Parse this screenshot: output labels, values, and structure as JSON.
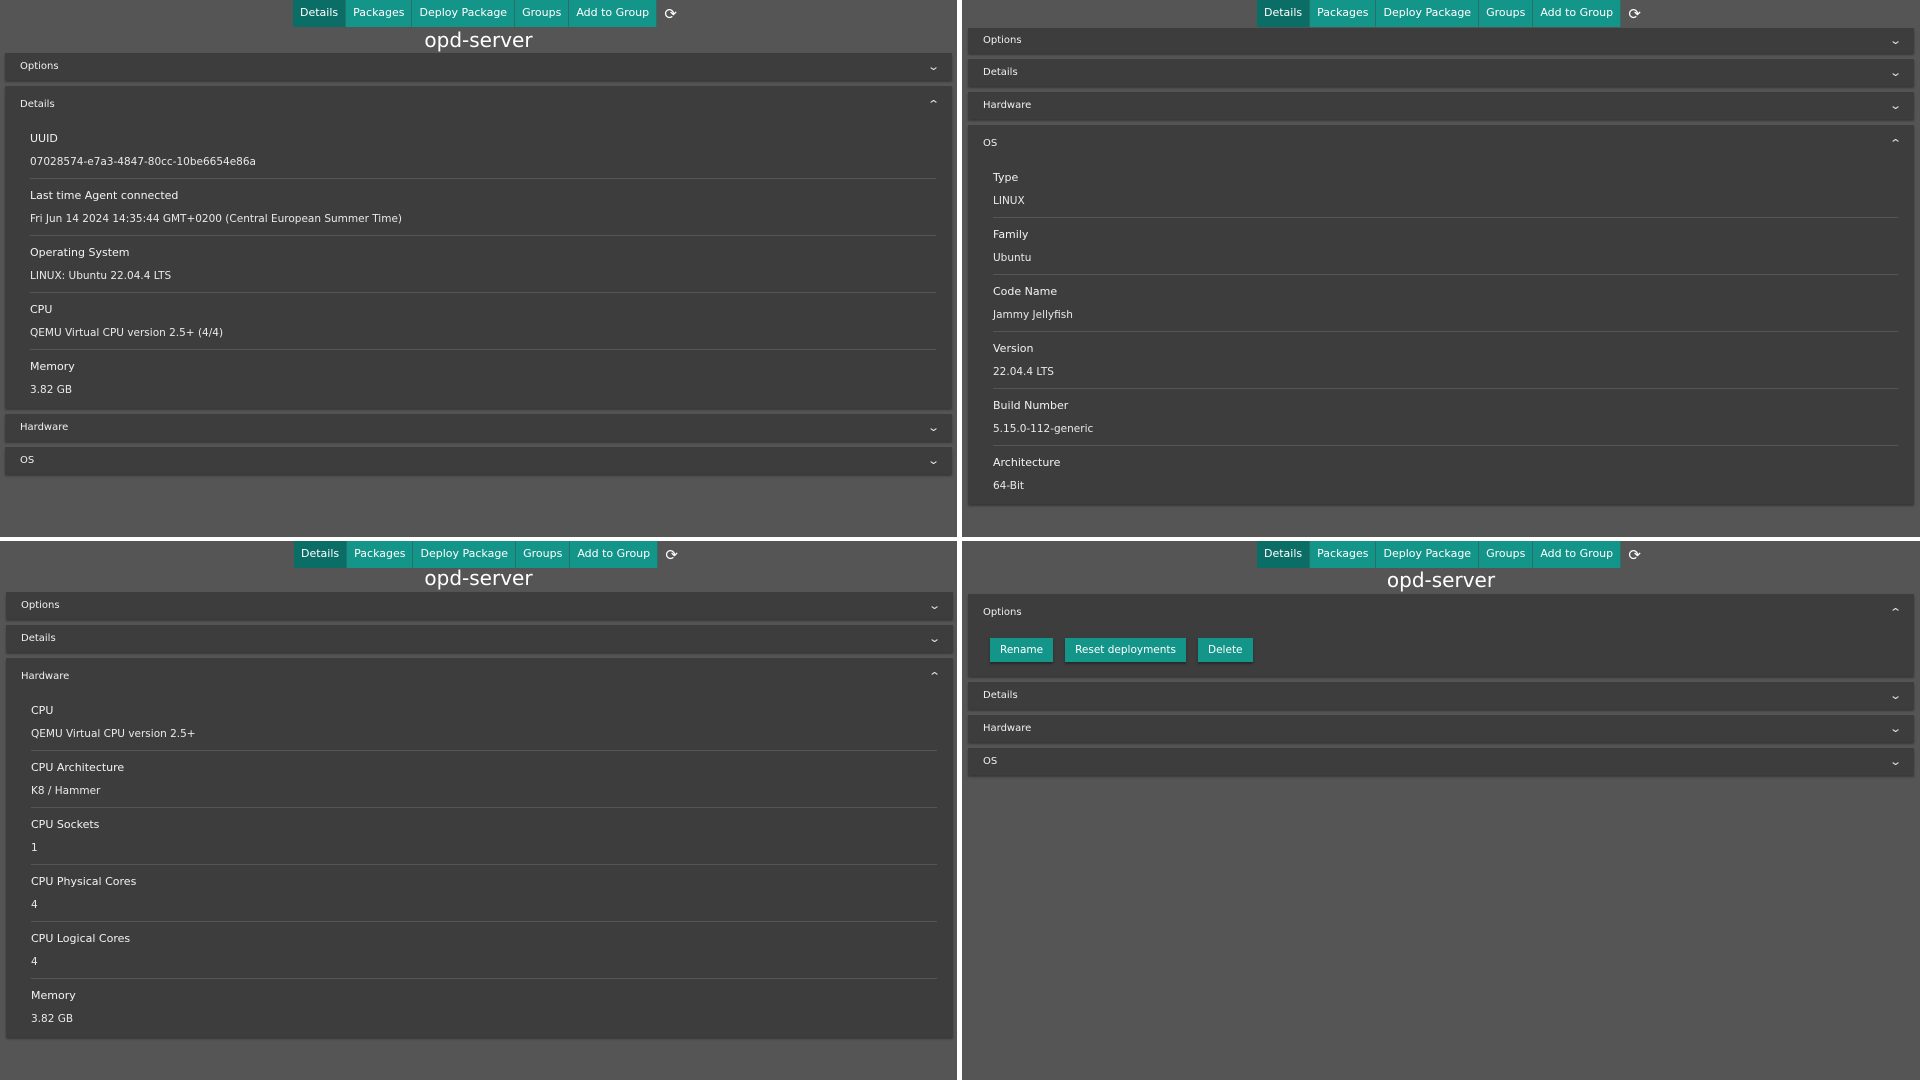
{
  "tabs": [
    "Details",
    "Packages",
    "Deploy Package",
    "Groups",
    "Add to Group"
  ],
  "refresh_icon": "refresh-icon",
  "server_name": "opd-server",
  "panels": {
    "options": "Options",
    "details": "Details",
    "hardware": "Hardware",
    "os": "OS"
  },
  "details_fields": [
    {
      "label": "UUID",
      "value": "07028574-e7a3-4847-80cc-10be6654e86a"
    },
    {
      "label": "Last time Agent connected",
      "value": "Fri Jun 14 2024 14:35:44 GMT+0200 (Central European Summer Time)"
    },
    {
      "label": "Operating System",
      "value": "LINUX: Ubuntu 22.04.4 LTS"
    },
    {
      "label": "CPU",
      "value": "QEMU Virtual CPU version 2.5+ (4/4)"
    },
    {
      "label": "Memory",
      "value": "3.82 GB"
    }
  ],
  "os_fields": [
    {
      "label": "Type",
      "value": "LINUX"
    },
    {
      "label": "Family",
      "value": "Ubuntu"
    },
    {
      "label": "Code Name",
      "value": "Jammy Jellyfish"
    },
    {
      "label": "Version",
      "value": "22.04.4 LTS"
    },
    {
      "label": "Build Number",
      "value": "5.15.0-112-generic"
    },
    {
      "label": "Architecture",
      "value": "64-Bit"
    }
  ],
  "hardware_fields": [
    {
      "label": "CPU",
      "value": "QEMU Virtual CPU version 2.5+"
    },
    {
      "label": "CPU Architecture",
      "value": "K8 / Hammer"
    },
    {
      "label": "CPU Sockets",
      "value": "1"
    },
    {
      "label": "CPU Physical Cores",
      "value": "4"
    },
    {
      "label": "CPU Logical Cores",
      "value": "4"
    },
    {
      "label": "Memory",
      "value": "3.82 GB"
    }
  ],
  "option_buttons": [
    "Rename",
    "Reset deployments",
    "Delete"
  ],
  "colors": {
    "accent": "#13958a",
    "accent_active": "#0b6e66",
    "panel": "#3d3d3d",
    "background": "#555555"
  }
}
